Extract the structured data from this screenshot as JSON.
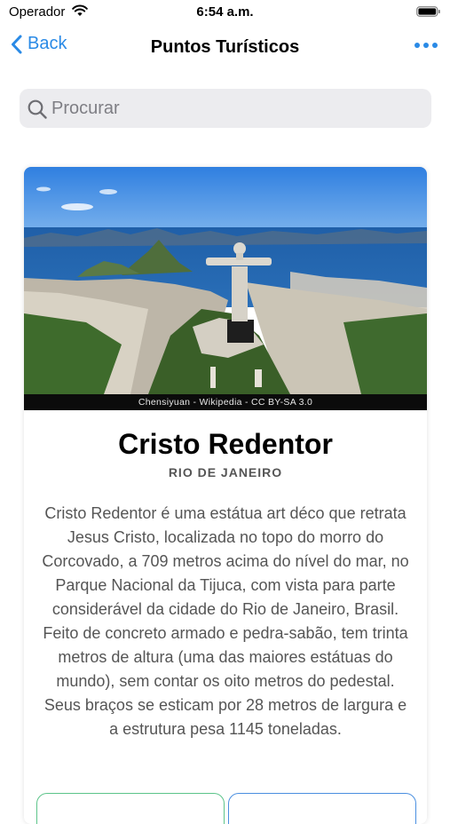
{
  "status": {
    "carrier": "Operador",
    "time": "6:54 a.m."
  },
  "nav": {
    "back_label": "Back",
    "title": "Puntos Turísticos"
  },
  "search": {
    "placeholder": "Procurar",
    "value": ""
  },
  "card": {
    "photo_credit": "Chensiyuan - Wikipedia - CC BY-SA 3.0",
    "title": "Cristo Redentor",
    "subtitle": "RIO DE JANEIRO",
    "description": "Cristo Redentor é uma estátua art déco que retrata Jesus Cristo, localizada no topo do morro do Corcovado, a 709 metros acima do nível do mar, no Parque Nacional da Tijuca, com vista para parte considerável da cidade do Rio de Janeiro, Brasil. Feito de concreto armado e pedra-sabão, tem trinta metros de altura (uma das maiores estátuas do mundo), sem contar os oito metros do pedestal. Seus braços se esticam por 28 metros de largura e a estrutura pesa 1145 toneladas."
  },
  "colors": {
    "accent": "#2a8ae6",
    "button_green": "#5cc48a",
    "button_blue": "#4a8fe0"
  }
}
